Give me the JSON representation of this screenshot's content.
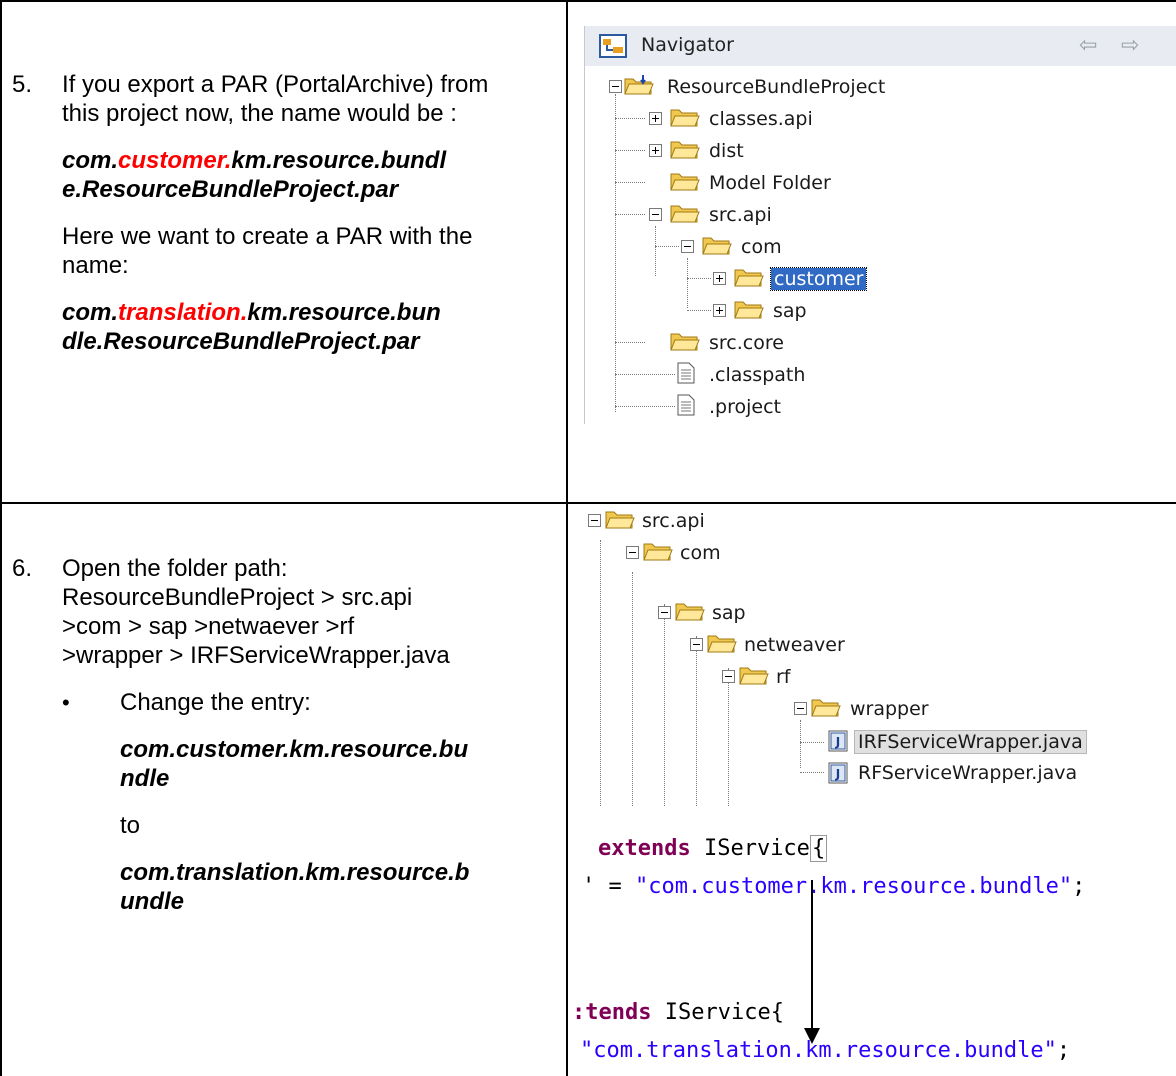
{
  "step5": {
    "number": "5.",
    "intro": "If you export a PAR (PortalArchive) from this project now,  the name would be :",
    "current_name": {
      "prefix": "com.",
      "highlight": "customer.",
      "suffix_line1": "km.resource.bundl",
      "suffix_line2": "e.ResourceBundleProject.par"
    },
    "want_text": "Here we want to create a PAR with the name:",
    "new_name": {
      "prefix": "com.",
      "highlight": "translation.",
      "suffix_line1": "km.resource.bun",
      "suffix_line2": "dle.ResourceBundleProject.par"
    }
  },
  "navigator": {
    "title": "Navigator",
    "back_arrow": "⇦",
    "forward_arrow": "⇨",
    "items": [
      {
        "label": "ResourceBundleProject"
      },
      {
        "label": "classes.api"
      },
      {
        "label": "dist"
      },
      {
        "label": "Model Folder"
      },
      {
        "label": "src.api"
      },
      {
        "label": "com"
      },
      {
        "label": "customer"
      },
      {
        "label": "sap"
      },
      {
        "label": "src.core"
      },
      {
        "label": ".classpath"
      },
      {
        "label": ".project"
      }
    ]
  },
  "step6": {
    "number": "6.",
    "line1": "Open the folder path:",
    "line2": "ResourceBundleProject > src.api",
    "line3": ">com > sap >netwaever >rf",
    "line4": ">wrapper > IRFServiceWrapper.java",
    "bullet_text": "Change the entry:",
    "old_entry_line1": "com.customer.km.resource.bu",
    "old_entry_line2": "ndle",
    "to_text": "to",
    "new_entry_line1": "com.translation.km.resource.b",
    "new_entry_line2": "undle"
  },
  "tree2": {
    "items": [
      {
        "label": "src.api"
      },
      {
        "label": "com"
      },
      {
        "label": "sap"
      },
      {
        "label": "netweaver"
      },
      {
        "label": "rf"
      },
      {
        "label": "wrapper"
      },
      {
        "label": "IRFServiceWrapper.java"
      },
      {
        "label": "RFServiceWrapper.java"
      }
    ]
  },
  "code": {
    "line1_kw": "extends",
    "line1_rest": " IService",
    "line1_brace": "{",
    "line2_prefix": "' = ",
    "line2_str": "\"com.customer.km.resource.bundle\"",
    "line2_end": ";",
    "line3_kw": ":tends",
    "line3_rest": " IService",
    "line3_brace": "{",
    "line4_str": "\"com.translation.km.resource.bundle\"",
    "line4_end": ";"
  }
}
